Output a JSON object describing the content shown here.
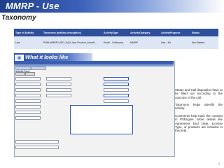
{
  "header": {
    "title": "MMRP - Use",
    "subtitle": "Taxonomy"
  },
  "taxonomy": {
    "columns": [
      "Type of Activity",
      "Taxonomy (activity description)",
      "ActivityType",
      "ActivityCategory",
      "ActivityPurpose",
      "Status"
    ],
    "row": [
      "Use",
      "PHM-MMRP-USE1-AQA-Use-Product_Mondil",
      "Email - Outbound",
      "MMRP",
      "Use - Kit",
      "Not Started"
    ]
  },
  "section": {
    "label": "What it looks like"
  },
  "screenshot": {
    "heading": "Activity Form"
  },
  "callouts": [
    "Status and Call disposition have to be filled out according to the outcome of the call.",
    "Taxonomy helps identify the activity.",
    "Comments help track the contract in PSEngine. More details like Agreement End Date, License Type, or products are included in this field."
  ],
  "page": {
    "number": "4"
  }
}
